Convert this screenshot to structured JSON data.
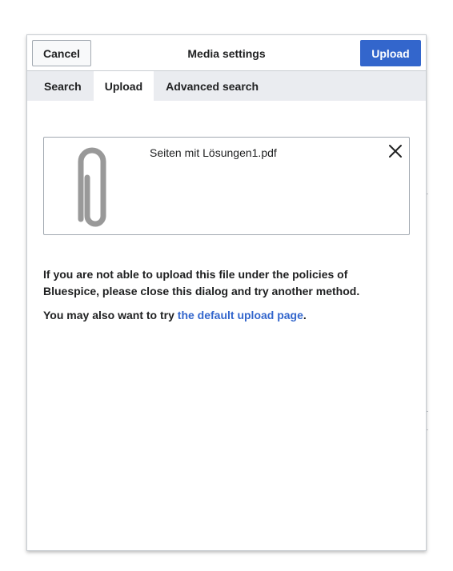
{
  "dialog": {
    "title": "Media settings",
    "cancel_label": "Cancel",
    "upload_label": "Upload"
  },
  "tabs": [
    {
      "label": "Search",
      "active": false
    },
    {
      "label": "Upload",
      "active": true
    },
    {
      "label": "Advanced search",
      "active": false
    }
  ],
  "file": {
    "name": "Seiten mit Lösungen1.pdf",
    "icon": "paperclip-icon",
    "remove_icon": "close-icon"
  },
  "notice": {
    "policy_text": "If you are not able to upload this file under the policies of Bluespice, please close this dialog and try another method.",
    "alt_prefix": "You may also want to try ",
    "alt_link": "the default upload page",
    "alt_suffix": "."
  },
  "colors": {
    "accent": "#3366cc",
    "border": "#c8ccd1",
    "tab_bar": "#eaecf0",
    "icon_gray": "#999999"
  }
}
